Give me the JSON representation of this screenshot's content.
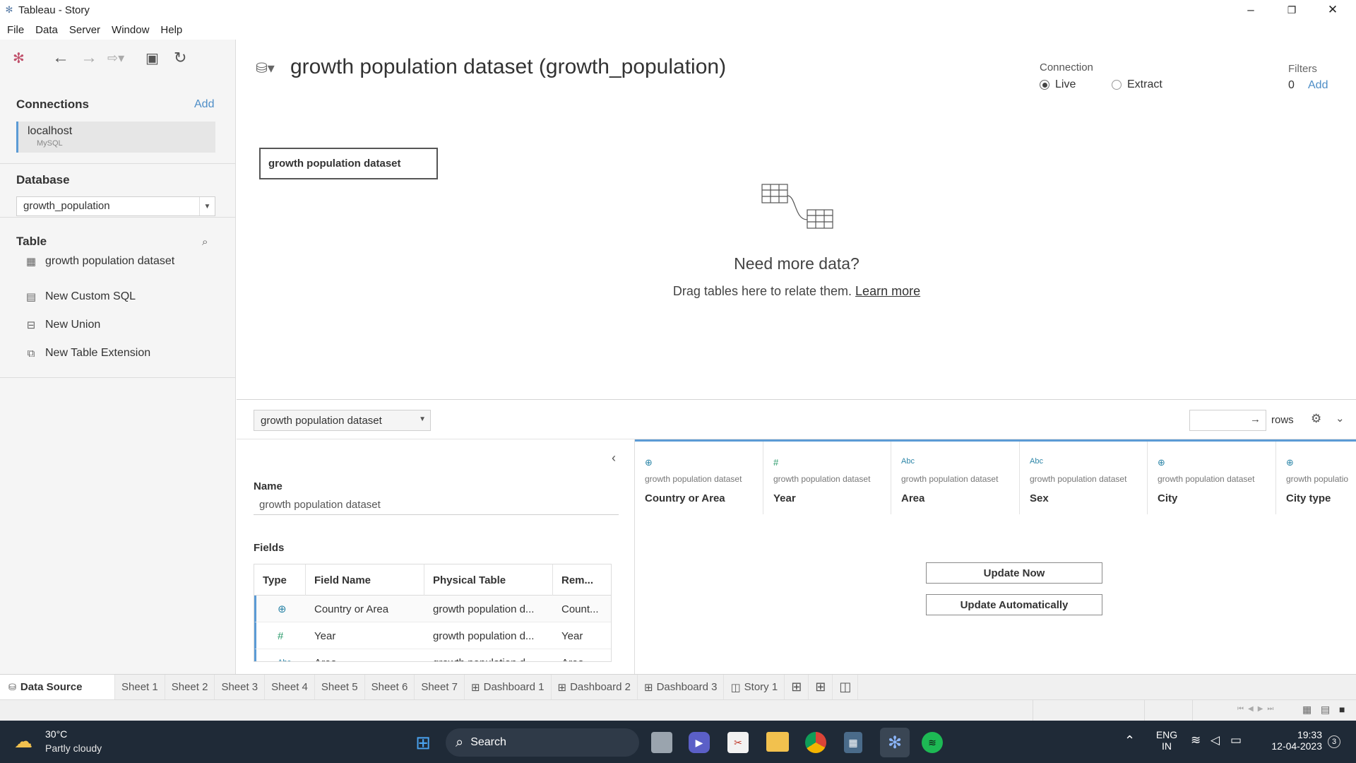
{
  "window": {
    "title": "Tableau - Story"
  },
  "menu": [
    "File",
    "Data",
    "Server",
    "Window",
    "Help"
  ],
  "left": {
    "connections_label": "Connections",
    "add_label": "Add",
    "connection": {
      "name": "localhost",
      "type": "MySQL"
    },
    "database_label": "Database",
    "database_value": "growth_population",
    "table_label": "Table",
    "table_item": "growth population dataset",
    "new_custom_sql": "New Custom SQL",
    "new_union": "New Union",
    "new_table_extension": "New Table Extension"
  },
  "canvas": {
    "title": "growth population dataset (growth_population)",
    "connection_label": "Connection",
    "live_label": "Live",
    "extract_label": "Extract",
    "selected_connection": "Live",
    "filters_label": "Filters",
    "filters_count": "0",
    "filters_add": "Add",
    "table_box": "growth population dataset",
    "need_more": "Need more data?",
    "drag_text": "Drag tables here to relate them.",
    "learn_more": "Learn more"
  },
  "preview": {
    "table_select": "growth population dataset",
    "rows_label": "rows",
    "name_label": "Name",
    "name_value": "growth population dataset",
    "fields_label": "Fields",
    "fields_headers": [
      "Type",
      "Field Name",
      "Physical Table",
      "Rem..."
    ],
    "fields_rows": [
      {
        "type_icon": "globe-icon",
        "name": "Country or Area",
        "physical": "growth population d...",
        "rem": "Count..."
      },
      {
        "type_icon": "number-icon",
        "name": "Year",
        "physical": "growth population d...",
        "rem": "Year"
      },
      {
        "type_icon": "abc-icon",
        "name": "Area",
        "physical": "growth population d...",
        "rem": "Area"
      }
    ],
    "columns": [
      {
        "icon": "globe-icon",
        "source": "growth population dataset",
        "name": "Country or Area"
      },
      {
        "icon": "number-icon",
        "source": "growth population dataset",
        "name": "Year"
      },
      {
        "icon": "abc-icon",
        "source": "growth population dataset",
        "name": "Area"
      },
      {
        "icon": "abc-icon",
        "source": "growth population dataset",
        "name": "Sex"
      },
      {
        "icon": "globe-icon",
        "source": "growth population dataset",
        "name": "City"
      },
      {
        "icon": "globe-icon",
        "source": "growth populatio",
        "name": "City type"
      }
    ],
    "update_now": "Update Now",
    "update_auto": "Update Automatically"
  },
  "tabs": [
    "Data Source",
    "Sheet 1",
    "Sheet 2",
    "Sheet 3",
    "Sheet 4",
    "Sheet 5",
    "Sheet 6",
    "Sheet 7",
    "Dashboard 1",
    "Dashboard 2",
    "Dashboard 3",
    "Story 1"
  ],
  "taskbar": {
    "weather_temp": "30°C",
    "weather_desc": "Partly cloudy",
    "search_label": "Search",
    "lang1": "ENG",
    "lang2": "IN",
    "time": "19:33",
    "date": "12-04-2023",
    "notif_count": "3"
  },
  "colors": {
    "accent": "#5b9bd5",
    "link": "#4e8ec7",
    "taskbar": "#1f2a37"
  }
}
